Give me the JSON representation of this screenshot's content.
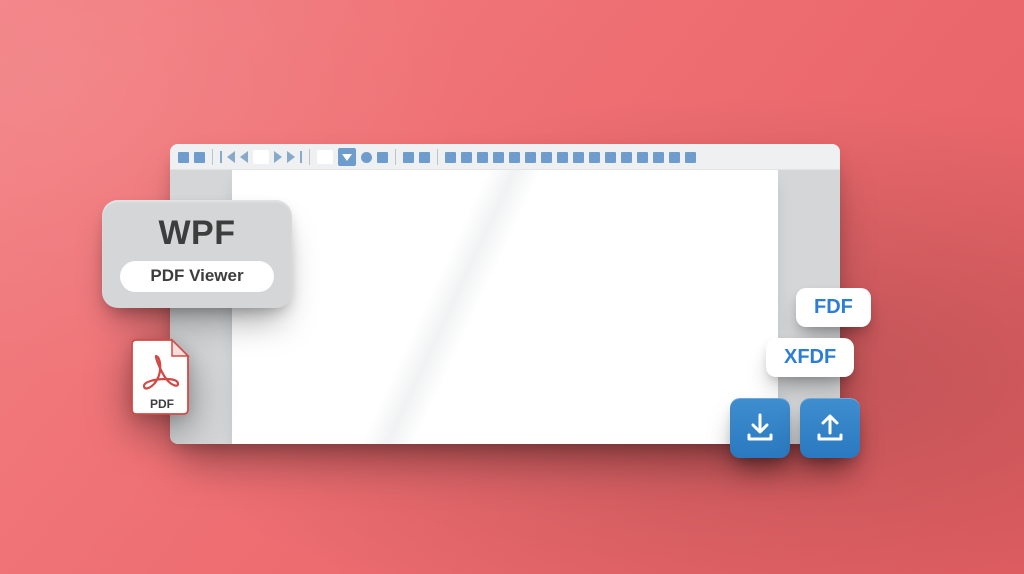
{
  "badge": {
    "title": "WPF",
    "subtitle": "PDF Viewer"
  },
  "pdf_file": {
    "caption": "PDF"
  },
  "pills": {
    "fdf": "FDF",
    "xfdf": "XFDF"
  },
  "colors": {
    "accent_blue": "#2d7dd6",
    "tool_blue": "#6e9ccc",
    "bg_coral": "#ee6e72"
  }
}
